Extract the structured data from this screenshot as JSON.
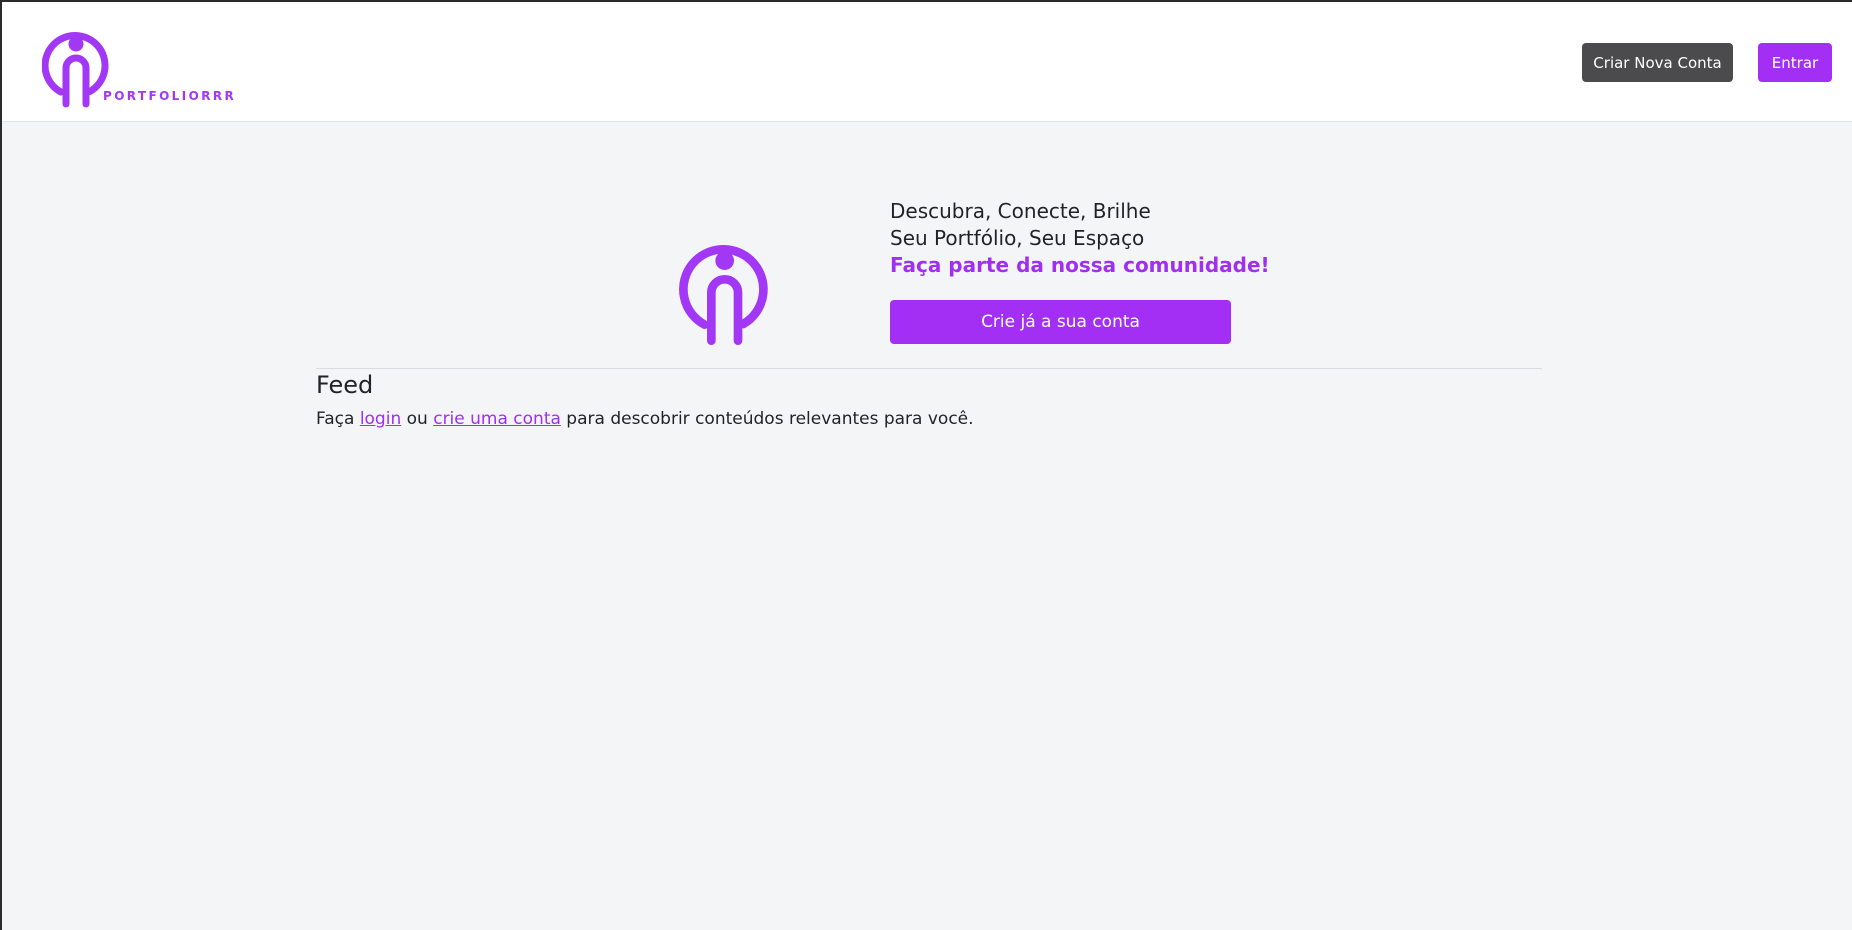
{
  "header": {
    "brand_name": "PORTFOLIORRR",
    "create_account_label": "Criar Nova Conta",
    "login_label": "Entrar"
  },
  "hero": {
    "line1": "Descubra, Conecte, Brilhe",
    "line2": "Seu Portfólio, Seu Espaço",
    "highlight": "Faça parte da nossa comunidade!",
    "cta_label": "Crie já a sua conta"
  },
  "feed": {
    "title": "Feed",
    "text_prefix": "Faça ",
    "login_link": "login",
    "text_middle": " ou ",
    "signup_link": "crie uma conta",
    "text_suffix": " para descobrir conteúdos relevantes para você."
  },
  "colors": {
    "brand_purple": "#a32ff5",
    "secondary_gray": "#4b4b4d",
    "background": "#f4f5f7"
  },
  "icons": {
    "brand_logo": "person-pin-logo-icon",
    "hero_logo": "person-pin-logo-icon"
  }
}
